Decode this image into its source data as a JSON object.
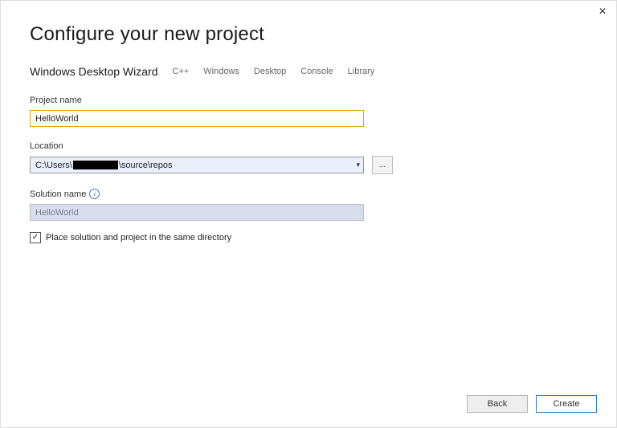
{
  "header": {
    "title": "Configure your new project",
    "template": "Windows Desktop Wizard",
    "tags": [
      "C++",
      "Windows",
      "Desktop",
      "Console",
      "Library"
    ]
  },
  "fields": {
    "project_name": {
      "label": "Project name",
      "value": "HelloWorld"
    },
    "location": {
      "label": "Location",
      "value_prefix": "C:\\Users\\",
      "value_suffix": "\\source\\repos",
      "browse_label": "..."
    },
    "solution_name": {
      "label": "Solution name",
      "value": "HelloWorld"
    },
    "same_directory": {
      "label": "Place solution and project in the same directory",
      "checked": true
    }
  },
  "footer": {
    "back": "Back",
    "create": "Create"
  }
}
